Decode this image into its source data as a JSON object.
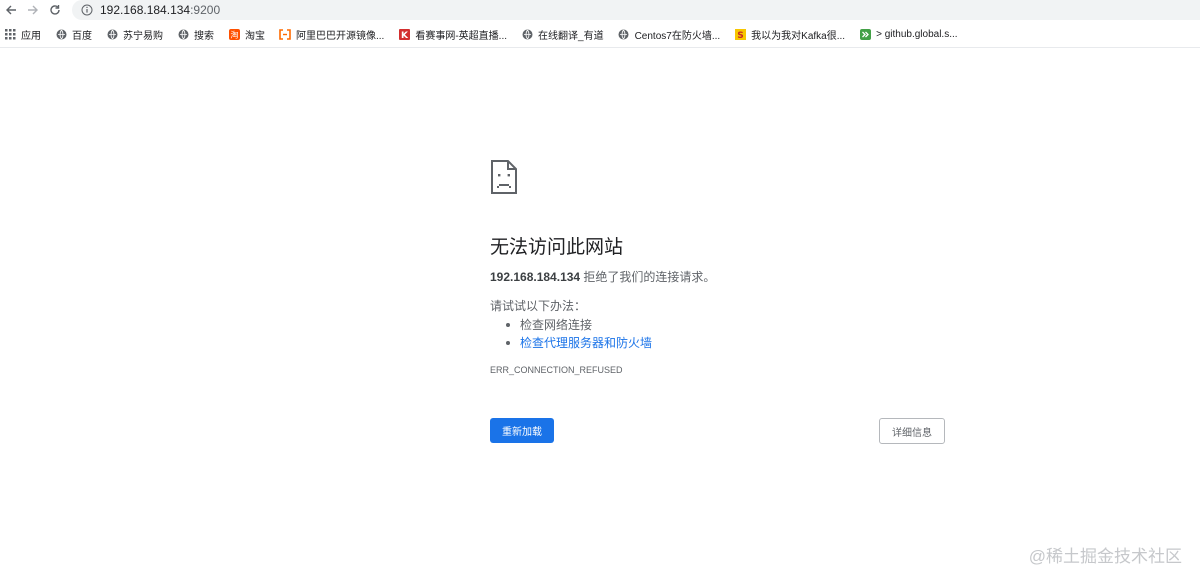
{
  "browser": {
    "url_host": "192.168.184.134",
    "url_port": ":9200",
    "icons": {
      "back": "arrow-left-icon",
      "forward": "arrow-right-icon",
      "reload": "reload-icon",
      "info": "info-icon"
    }
  },
  "bookmarks": [
    {
      "label": "应用",
      "icon": "apps-grid-icon"
    },
    {
      "label": "百度",
      "icon": "globe-icon"
    },
    {
      "label": "苏宁易购",
      "icon": "globe-icon"
    },
    {
      "label": "搜索",
      "icon": "globe-icon"
    },
    {
      "label": "淘宝",
      "icon": "taobao-icon"
    },
    {
      "label": "阿里巴巴开源镜像...",
      "icon": "aliyun-icon"
    },
    {
      "label": "看赛事网-英超直播...",
      "icon": "k-logo-icon"
    },
    {
      "label": "在线翻译_有道",
      "icon": "globe-icon"
    },
    {
      "label": "Centos7在防火墙...",
      "icon": "globe-icon"
    },
    {
      "label": "我以为我对Kafka很...",
      "icon": "s-logo-icon"
    },
    {
      "label": "> github.global.s...",
      "icon": "forward-arrows-icon"
    }
  ],
  "error_page": {
    "icon": "sad-document-icon",
    "title": "无法访问此网站",
    "host": "192.168.184.134",
    "desc_suffix": " 拒绝了我们的连接请求。",
    "try_label": "请试试以下办法：",
    "suggestions": [
      "检查网络连接",
      "检查代理服务器和防火墙"
    ],
    "error_code": "ERR_CONNECTION_REFUSED",
    "reload_label": "重新加载",
    "details_label": "详细信息"
  },
  "watermark": "@稀土掘金技术社区",
  "colors": {
    "primary_button": "#1a73e8",
    "link": "#1a73e8",
    "text_secondary": "#5f6368",
    "omnibox_bg": "#f1f3f4"
  }
}
